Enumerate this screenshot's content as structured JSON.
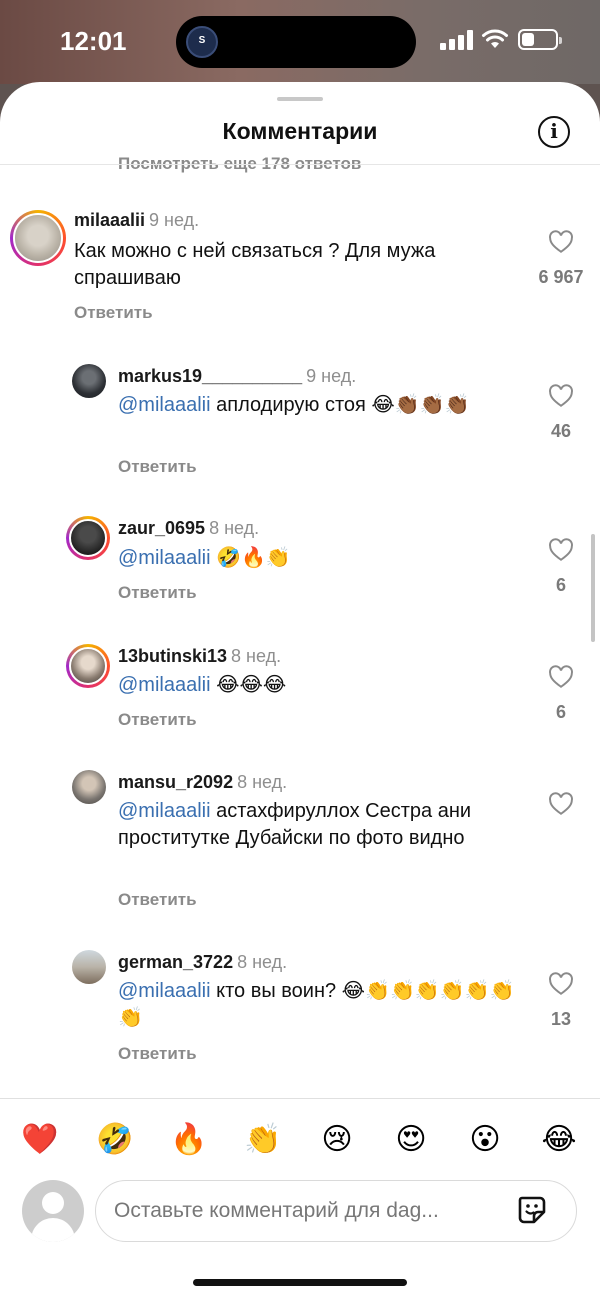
{
  "status": {
    "time": "12:01",
    "vpn_label": "S"
  },
  "sheet": {
    "title": "Комментарии",
    "more_replies": "Посмотреть еще 178 ответов"
  },
  "comments": [
    {
      "username": "milaaalii",
      "ago": "9 нед.",
      "text": "Как можно с ней связаться ? Для мужа спрашиваю",
      "reply": "Ответить",
      "likes": "6 967"
    },
    {
      "username": "markus19__________",
      "ago": "9 нед.",
      "mention": "@milaaalii",
      "text": " аплодирую стоя 😂👏🏾👏🏾👏🏾",
      "reply": "Ответить",
      "likes": "46"
    },
    {
      "username": "zaur_0695",
      "ago": "8 нед.",
      "mention": "@milaaalii",
      "text": " 🤣🔥👏",
      "reply": "Ответить",
      "likes": "6"
    },
    {
      "username": "13butinski13",
      "ago": "8 нед.",
      "mention": "@milaaalii",
      "text": " 😂😂😂",
      "reply": "Ответить",
      "likes": "6"
    },
    {
      "username": "mansu_r2092",
      "ago": "8 нед.",
      "mention": "@milaaalii",
      "text": " астахфируллох Сестра ани проститутке Дубайски по фото видно",
      "reply": "Ответить",
      "likes": ""
    },
    {
      "username": "german_3722",
      "ago": "8 нед.",
      "mention": "@milaaalii",
      "text": " кто вы воин? 😂👏👏👏👏👏👏👏",
      "reply": "Ответить",
      "likes": "13"
    }
  ],
  "quick_emojis": [
    "❤️",
    "🤣",
    "🔥",
    "👏",
    "😢",
    "😍",
    "😮",
    "😂"
  ],
  "composer": {
    "placeholder": "Оставьте комментарий для dag..."
  },
  "colors": {
    "mention": "#3a6fb0",
    "muted": "#8a8a8a"
  }
}
